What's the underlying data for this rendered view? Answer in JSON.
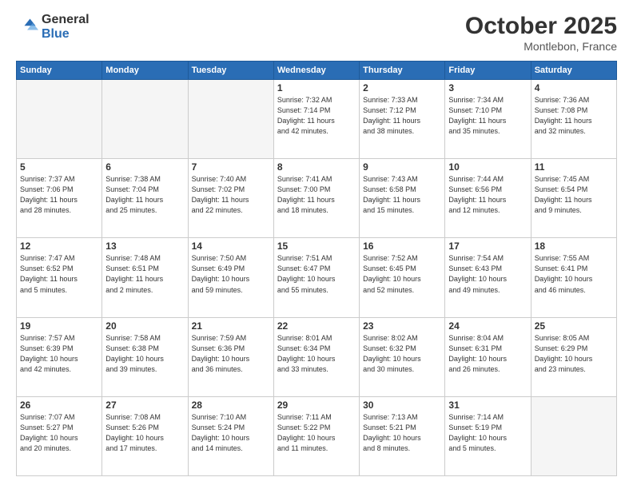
{
  "header": {
    "logo_general": "General",
    "logo_blue": "Blue",
    "month": "October 2025",
    "location": "Montlebon, France"
  },
  "weekdays": [
    "Sunday",
    "Monday",
    "Tuesday",
    "Wednesday",
    "Thursday",
    "Friday",
    "Saturday"
  ],
  "weeks": [
    [
      {
        "day": "",
        "info": "",
        "empty": true
      },
      {
        "day": "",
        "info": "",
        "empty": true
      },
      {
        "day": "",
        "info": "",
        "empty": true
      },
      {
        "day": "1",
        "info": "Sunrise: 7:32 AM\nSunset: 7:14 PM\nDaylight: 11 hours\nand 42 minutes.",
        "empty": false
      },
      {
        "day": "2",
        "info": "Sunrise: 7:33 AM\nSunset: 7:12 PM\nDaylight: 11 hours\nand 38 minutes.",
        "empty": false
      },
      {
        "day": "3",
        "info": "Sunrise: 7:34 AM\nSunset: 7:10 PM\nDaylight: 11 hours\nand 35 minutes.",
        "empty": false
      },
      {
        "day": "4",
        "info": "Sunrise: 7:36 AM\nSunset: 7:08 PM\nDaylight: 11 hours\nand 32 minutes.",
        "empty": false
      }
    ],
    [
      {
        "day": "5",
        "info": "Sunrise: 7:37 AM\nSunset: 7:06 PM\nDaylight: 11 hours\nand 28 minutes.",
        "empty": false
      },
      {
        "day": "6",
        "info": "Sunrise: 7:38 AM\nSunset: 7:04 PM\nDaylight: 11 hours\nand 25 minutes.",
        "empty": false
      },
      {
        "day": "7",
        "info": "Sunrise: 7:40 AM\nSunset: 7:02 PM\nDaylight: 11 hours\nand 22 minutes.",
        "empty": false
      },
      {
        "day": "8",
        "info": "Sunrise: 7:41 AM\nSunset: 7:00 PM\nDaylight: 11 hours\nand 18 minutes.",
        "empty": false
      },
      {
        "day": "9",
        "info": "Sunrise: 7:43 AM\nSunset: 6:58 PM\nDaylight: 11 hours\nand 15 minutes.",
        "empty": false
      },
      {
        "day": "10",
        "info": "Sunrise: 7:44 AM\nSunset: 6:56 PM\nDaylight: 11 hours\nand 12 minutes.",
        "empty": false
      },
      {
        "day": "11",
        "info": "Sunrise: 7:45 AM\nSunset: 6:54 PM\nDaylight: 11 hours\nand 9 minutes.",
        "empty": false
      }
    ],
    [
      {
        "day": "12",
        "info": "Sunrise: 7:47 AM\nSunset: 6:52 PM\nDaylight: 11 hours\nand 5 minutes.",
        "empty": false
      },
      {
        "day": "13",
        "info": "Sunrise: 7:48 AM\nSunset: 6:51 PM\nDaylight: 11 hours\nand 2 minutes.",
        "empty": false
      },
      {
        "day": "14",
        "info": "Sunrise: 7:50 AM\nSunset: 6:49 PM\nDaylight: 10 hours\nand 59 minutes.",
        "empty": false
      },
      {
        "day": "15",
        "info": "Sunrise: 7:51 AM\nSunset: 6:47 PM\nDaylight: 10 hours\nand 55 minutes.",
        "empty": false
      },
      {
        "day": "16",
        "info": "Sunrise: 7:52 AM\nSunset: 6:45 PM\nDaylight: 10 hours\nand 52 minutes.",
        "empty": false
      },
      {
        "day": "17",
        "info": "Sunrise: 7:54 AM\nSunset: 6:43 PM\nDaylight: 10 hours\nand 49 minutes.",
        "empty": false
      },
      {
        "day": "18",
        "info": "Sunrise: 7:55 AM\nSunset: 6:41 PM\nDaylight: 10 hours\nand 46 minutes.",
        "empty": false
      }
    ],
    [
      {
        "day": "19",
        "info": "Sunrise: 7:57 AM\nSunset: 6:39 PM\nDaylight: 10 hours\nand 42 minutes.",
        "empty": false
      },
      {
        "day": "20",
        "info": "Sunrise: 7:58 AM\nSunset: 6:38 PM\nDaylight: 10 hours\nand 39 minutes.",
        "empty": false
      },
      {
        "day": "21",
        "info": "Sunrise: 7:59 AM\nSunset: 6:36 PM\nDaylight: 10 hours\nand 36 minutes.",
        "empty": false
      },
      {
        "day": "22",
        "info": "Sunrise: 8:01 AM\nSunset: 6:34 PM\nDaylight: 10 hours\nand 33 minutes.",
        "empty": false
      },
      {
        "day": "23",
        "info": "Sunrise: 8:02 AM\nSunset: 6:32 PM\nDaylight: 10 hours\nand 30 minutes.",
        "empty": false
      },
      {
        "day": "24",
        "info": "Sunrise: 8:04 AM\nSunset: 6:31 PM\nDaylight: 10 hours\nand 26 minutes.",
        "empty": false
      },
      {
        "day": "25",
        "info": "Sunrise: 8:05 AM\nSunset: 6:29 PM\nDaylight: 10 hours\nand 23 minutes.",
        "empty": false
      }
    ],
    [
      {
        "day": "26",
        "info": "Sunrise: 7:07 AM\nSunset: 5:27 PM\nDaylight: 10 hours\nand 20 minutes.",
        "empty": false
      },
      {
        "day": "27",
        "info": "Sunrise: 7:08 AM\nSunset: 5:26 PM\nDaylight: 10 hours\nand 17 minutes.",
        "empty": false
      },
      {
        "day": "28",
        "info": "Sunrise: 7:10 AM\nSunset: 5:24 PM\nDaylight: 10 hours\nand 14 minutes.",
        "empty": false
      },
      {
        "day": "29",
        "info": "Sunrise: 7:11 AM\nSunset: 5:22 PM\nDaylight: 10 hours\nand 11 minutes.",
        "empty": false
      },
      {
        "day": "30",
        "info": "Sunrise: 7:13 AM\nSunset: 5:21 PM\nDaylight: 10 hours\nand 8 minutes.",
        "empty": false
      },
      {
        "day": "31",
        "info": "Sunrise: 7:14 AM\nSunset: 5:19 PM\nDaylight: 10 hours\nand 5 minutes.",
        "empty": false
      },
      {
        "day": "",
        "info": "",
        "empty": true
      }
    ]
  ]
}
